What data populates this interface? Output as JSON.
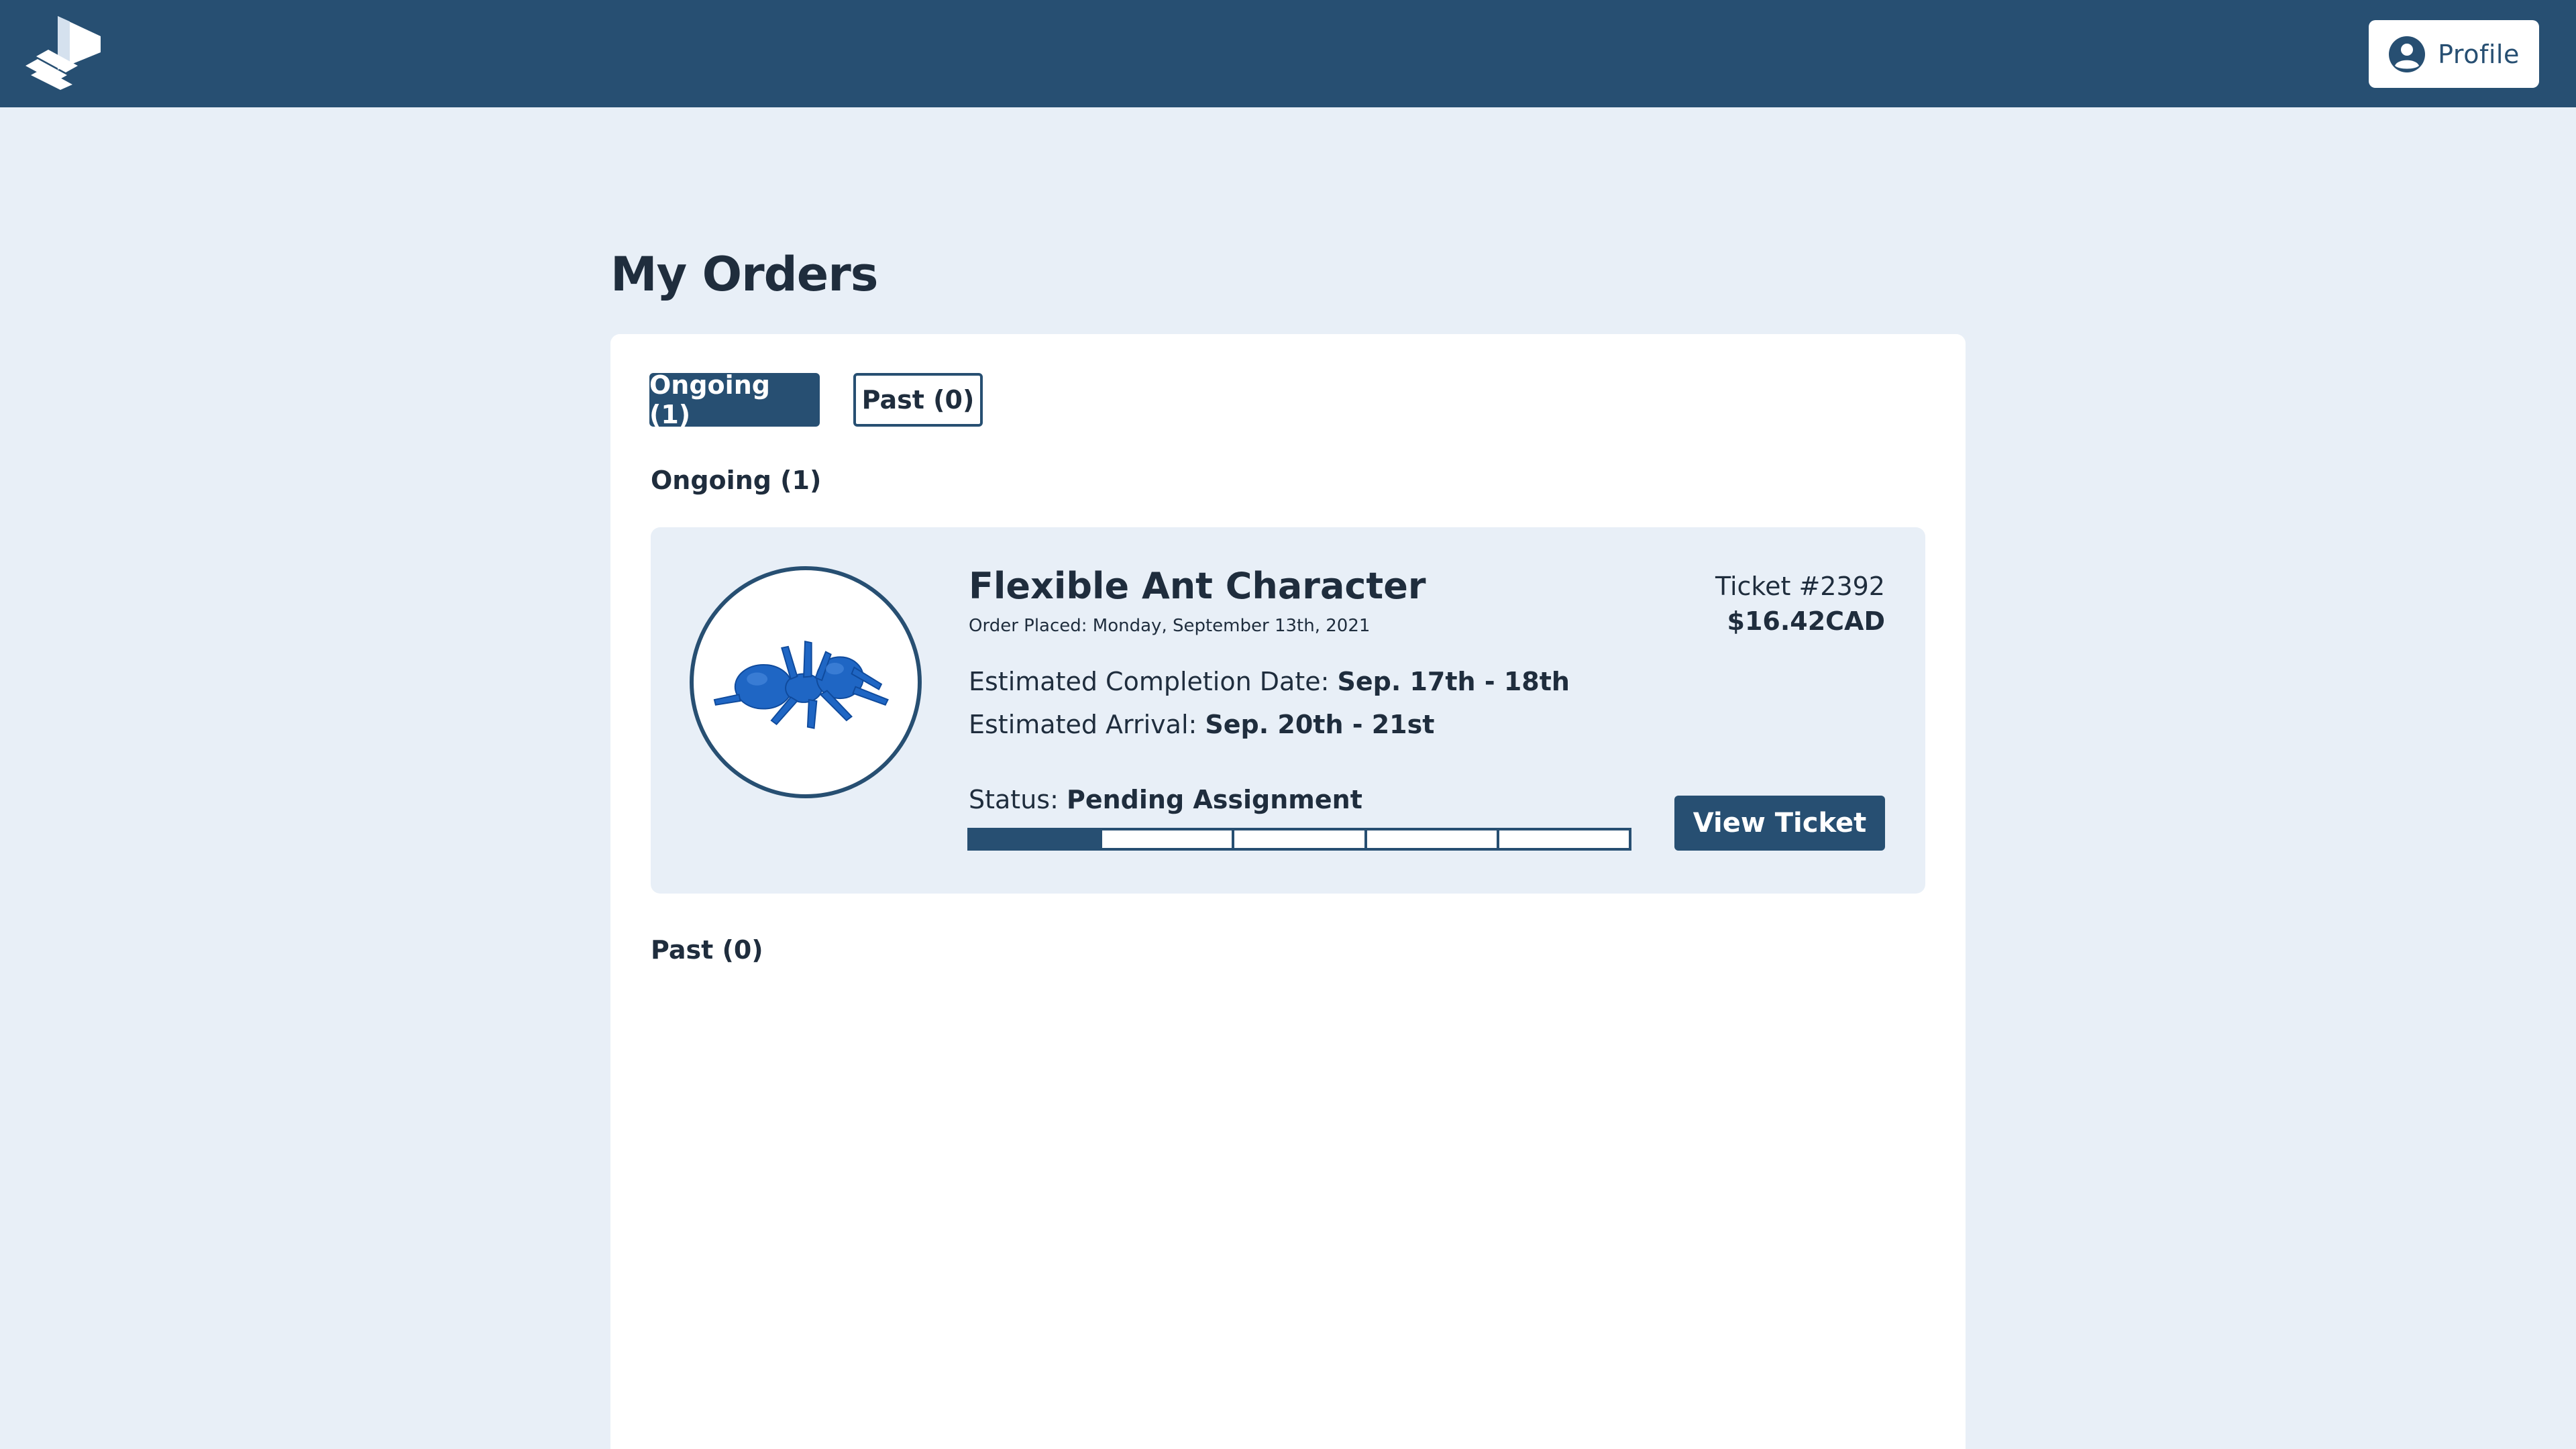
{
  "header": {
    "logo_icon": "stacked-flag-logo-icon",
    "profile_label": "Profile",
    "profile_icon": "user-circle-icon"
  },
  "page": {
    "title": "My Orders"
  },
  "tabs": [
    {
      "label": "Ongoing (1)",
      "active": true
    },
    {
      "label": "Past (0)",
      "active": false
    }
  ],
  "sections": {
    "ongoing_label": "Ongoing (1)",
    "past_label": "Past (0)"
  },
  "order": {
    "title": "Flexible Ant Character",
    "order_placed": "Order Placed: Monday, September 13th, 2021",
    "est_completion_label": "Estimated Completion Date: ",
    "est_completion_value": "Sep. 17th - 18th",
    "est_arrival_label": "Estimated Arrival: ",
    "est_arrival_value": "Sep. 20th - 21st",
    "status_label": "Status: ",
    "status_value": "Pending Assignment",
    "progress": {
      "completed_steps": 1,
      "total_steps": 5
    },
    "ticket_number": "Ticket #2392",
    "price": "$16.42CAD",
    "view_ticket_label": "View Ticket",
    "thumbnail_icon": "ant-model-icon"
  },
  "colors": {
    "navy": "#274f72",
    "page_bg": "#e8eff7",
    "card_bg": "#e8eff7",
    "panel_bg": "#ffffff",
    "ant_blue": "#1f66c4"
  }
}
